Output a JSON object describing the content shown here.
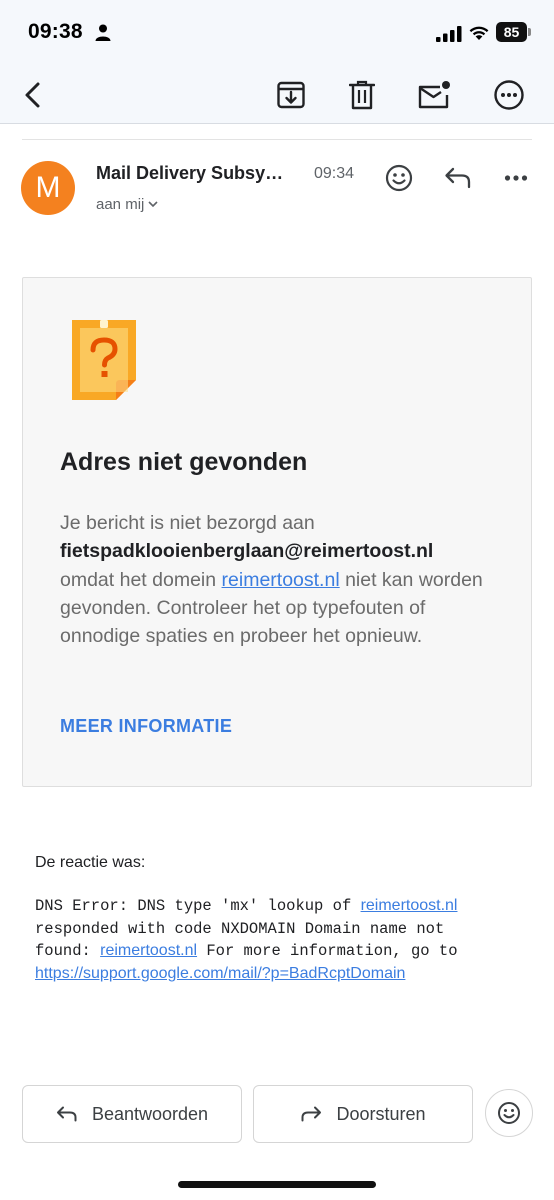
{
  "status_bar": {
    "time": "09:38",
    "battery": "85",
    "icons": [
      "person-icon",
      "signal-icon",
      "wifi-icon",
      "battery-icon"
    ]
  },
  "toolbar": {
    "icons": [
      "back-icon",
      "archive-icon",
      "delete-icon",
      "mark-unread-icon",
      "more-icon"
    ]
  },
  "message": {
    "avatar_letter": "M",
    "avatar_color": "#f4811f",
    "sender": "Mail Delivery Subsy…",
    "time": "09:34",
    "recipient": "aan mij",
    "header_icons": [
      "emoji-reaction-icon",
      "reply-icon",
      "more-options-icon"
    ]
  },
  "bounce_card": {
    "icon": "unknown-document-icon",
    "title": "Adres niet gevonden",
    "body_prefix": "Je bericht is niet bezorgd aan",
    "address": "fietspadklooienberglaan@reimertoost.nl",
    "body_mid1": "omdat het domein",
    "domain_link": "reimertoost.nl",
    "body_mid2": "niet kan",
    "body_suffix": "worden gevonden. Controleer het op typefouten of onnodige spaties en probeer het opnieuw.",
    "more_info": "MEER INFORMATIE"
  },
  "reply": {
    "label": "De reactie was:",
    "line1_prefix": "DNS Error: DNS type 'mx' lookup of ",
    "line1_link": "reimertoost.nl",
    "line2": "responded with code NXDOMAIN Domain name not",
    "line3_prefix": "found: ",
    "line3_link": "reimertoost.nl",
    "line3_suffix": " For more information, go to",
    "support_link": "https://support.google.com/mail/?p=BadRcptDomain"
  },
  "actions": {
    "reply_label": "Beantwoorden",
    "forward_label": "Doorsturen",
    "icons": [
      "reply-icon",
      "forward-icon",
      "emoji-icon"
    ]
  },
  "colors": {
    "accent": "#3b7de0",
    "header_bg": "#f5f8fc",
    "card_bg": "#f7f7f7",
    "doc_icon": "#f9a825"
  }
}
